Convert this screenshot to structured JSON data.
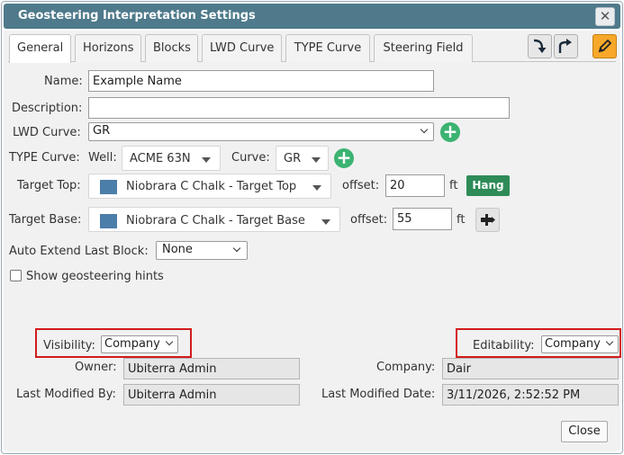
{
  "dialog": {
    "title": "Geosteering Interpretation Settings",
    "close_glyph": "✕"
  },
  "tabs": [
    {
      "label": "General",
      "active": true
    },
    {
      "label": "Horizons",
      "active": false
    },
    {
      "label": "Blocks",
      "active": false
    },
    {
      "label": "LWD Curve",
      "active": false
    },
    {
      "label": "TYPE Curve",
      "active": false
    },
    {
      "label": "Steering Field",
      "active": false
    }
  ],
  "toolbar_icons": [
    "import-icon",
    "share-icon",
    "pencil-icon"
  ],
  "form": {
    "name_label": "Name:",
    "name_value": "Example Name",
    "description_label": "Description:",
    "description_value": "",
    "lwd_label": "LWD Curve:",
    "lwd_value": "GR",
    "type_label": "TYPE Curve:",
    "well_label": "Well:",
    "well_value": "ACME 63N",
    "curve_label": "Curve:",
    "curve_value": "GR",
    "target_top_label": "Target Top:",
    "target_top_value": "Niobrara C Chalk - Target Top",
    "target_top_color": "#4b7ea9",
    "offset_label": "offset:",
    "target_top_offset": "20",
    "unit_ft": "ft",
    "hang_label": "Hang",
    "target_base_label": "Target Base:",
    "target_base_value": "Niobrara C Chalk - Target Base",
    "target_base_color": "#4b7ea9",
    "target_base_offset": "55",
    "auto_extend_label": "Auto Extend Last Block:",
    "auto_extend_value": "None",
    "hints_label": "Show geosteering hints",
    "hints_checked": false
  },
  "footer": {
    "visibility_label": "Visibility:",
    "visibility_value": "Company",
    "editability_label": "Editability:",
    "editability_value": "Company",
    "owner_label": "Owner:",
    "owner_value": "Ubiterra Admin",
    "company_label": "Company:",
    "company_value": "Dair",
    "modified_by_label": "Last Modified By:",
    "modified_by_value": "Ubiterra Admin",
    "modified_date_label": "Last Modified Date:",
    "modified_date_value": "3/11/2026, 2:52:52 PM",
    "close_label": "Close"
  },
  "colors": {
    "titlebar": "#4e7a8b",
    "accent_green": "#2e8b57",
    "add_green": "#3bb371",
    "edit_orange": "#f7a82a",
    "highlight_red": "#d21b1b"
  }
}
